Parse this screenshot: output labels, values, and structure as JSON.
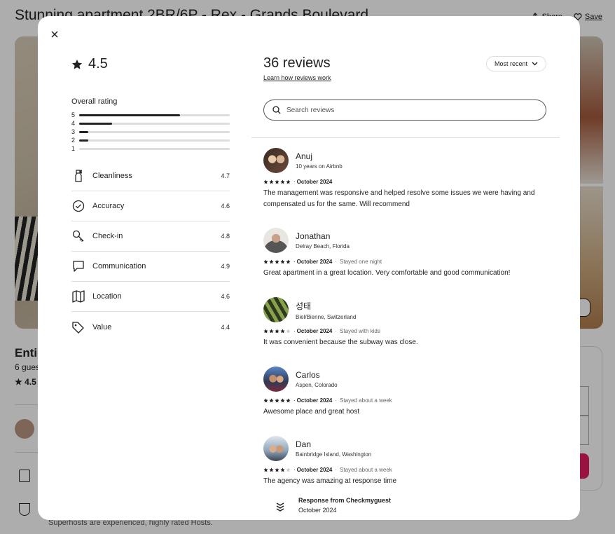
{
  "background": {
    "title": "Stunning apartment 2BR/6P - Rex - Grands Boulevard",
    "share_label": "Share",
    "save_label": "Save",
    "type_text": "Enti",
    "guests_text": "6 gues",
    "rating_text": "★ 4.5",
    "superhost_text": "Superhosts are experienced, highly rated Hosts."
  },
  "modal": {
    "close_icon": "close-icon",
    "overall_score": "4.5",
    "overall_label": "Overall rating",
    "distribution": [
      {
        "stars": "5",
        "fraction": 0.67
      },
      {
        "stars": "4",
        "fraction": 0.22
      },
      {
        "stars": "3",
        "fraction": 0.06
      },
      {
        "stars": "2",
        "fraction": 0.06
      },
      {
        "stars": "1",
        "fraction": 0.0
      }
    ],
    "categories": [
      {
        "name": "Cleanliness",
        "value": "4.7",
        "icon": "spray-bottle-icon"
      },
      {
        "name": "Accuracy",
        "value": "4.6",
        "icon": "check-circle-icon"
      },
      {
        "name": "Check-in",
        "value": "4.8",
        "icon": "key-icon"
      },
      {
        "name": "Communication",
        "value": "4.9",
        "icon": "chat-bubble-icon"
      },
      {
        "name": "Location",
        "value": "4.6",
        "icon": "map-icon"
      },
      {
        "name": "Value",
        "value": "4.4",
        "icon": "tag-icon"
      }
    ],
    "reviews_title": "36 reviews",
    "learn_link": "Learn how reviews work",
    "sort_label": "Most recent",
    "search_placeholder": "Search reviews",
    "reviews": [
      {
        "name": "Anuj",
        "sub": "10 years on Airbnb",
        "stars": 5,
        "date": "October 2024",
        "stay": "",
        "text": "The management was responsive and helped resolve some issues we were having and compensated us for the same. Will recommend"
      },
      {
        "name": "Jonathan",
        "sub": "Delray Beach, Florida",
        "stars": 5,
        "date": "October 2024",
        "stay": "Stayed one night",
        "text": "Great apartment in a great location. Very comfortable and good communication!"
      },
      {
        "name": "성태",
        "sub": "Biel/Bienne, Switzerland",
        "stars": 4,
        "date": "October 2024",
        "stay": "Stayed with kids",
        "text": "It was convenient because the subway was close."
      },
      {
        "name": "Carlos",
        "sub": "Aspen, Colorado",
        "stars": 5,
        "date": "October 2024",
        "stay": "Stayed about a week",
        "text": "Awesome place and great host"
      },
      {
        "name": "Dan",
        "sub": "Bainbridge Island, Washington",
        "stars": 4,
        "date": "October 2024",
        "stay": "Stayed about a week",
        "text": "The agency was amazing at response time"
      }
    ],
    "response": {
      "title": "Response from Checkmyguest",
      "date": "October 2024"
    },
    "colors": {
      "accent": "#e31c5f",
      "text": "#222222",
      "divider": "#dddddd"
    }
  }
}
